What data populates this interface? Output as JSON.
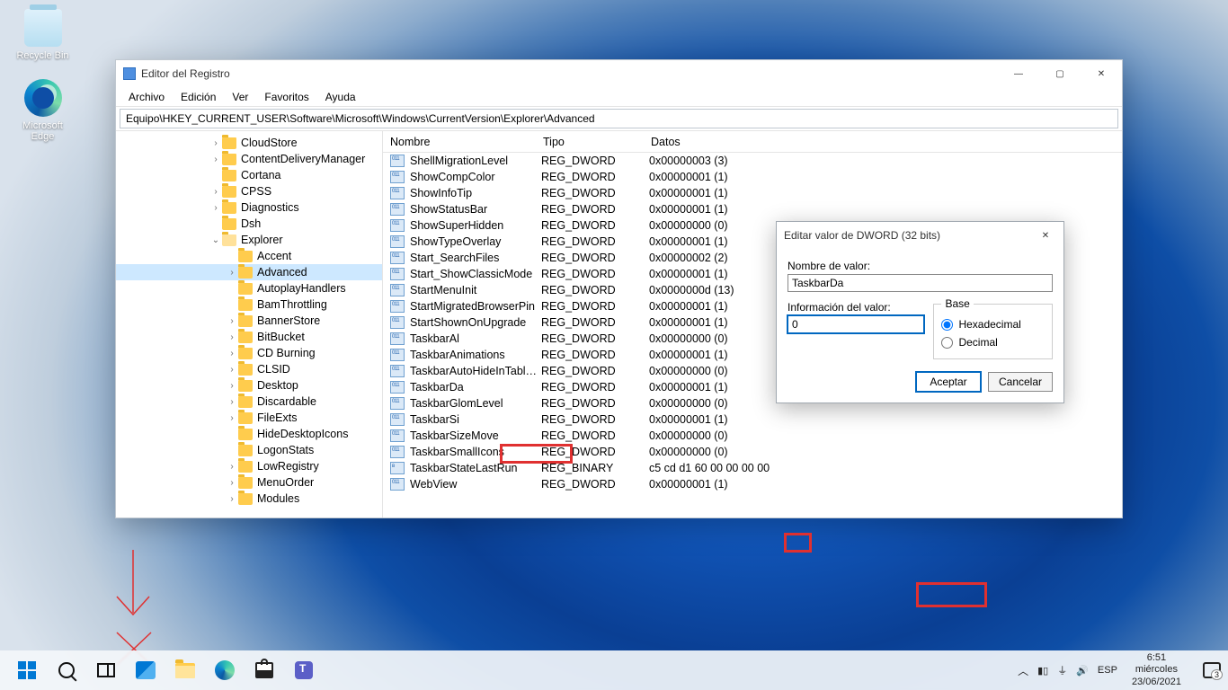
{
  "desktop": {
    "recycle_bin": "Recycle Bin",
    "edge": "Microsoft\nEdge"
  },
  "regedit": {
    "title": "Editor del Registro",
    "menu": [
      "Archivo",
      "Edición",
      "Ver",
      "Favoritos",
      "Ayuda"
    ],
    "address": "Equipo\\HKEY_CURRENT_USER\\Software\\Microsoft\\Windows\\CurrentVersion\\Explorer\\Advanced",
    "tree": [
      {
        "indent": 104,
        "exp": ">",
        "label": "CloudStore"
      },
      {
        "indent": 104,
        "exp": ">",
        "label": "ContentDeliveryManager"
      },
      {
        "indent": 104,
        "exp": "",
        "label": "Cortana"
      },
      {
        "indent": 104,
        "exp": ">",
        "label": "CPSS"
      },
      {
        "indent": 104,
        "exp": ">",
        "label": "Diagnostics"
      },
      {
        "indent": 104,
        "exp": "",
        "label": "Dsh"
      },
      {
        "indent": 104,
        "exp": "v",
        "label": "Explorer",
        "open": true
      },
      {
        "indent": 122,
        "exp": "",
        "label": "Accent"
      },
      {
        "indent": 122,
        "exp": ">",
        "label": "Advanced",
        "selected": true
      },
      {
        "indent": 122,
        "exp": "",
        "label": "AutoplayHandlers"
      },
      {
        "indent": 122,
        "exp": "",
        "label": "BamThrottling"
      },
      {
        "indent": 122,
        "exp": ">",
        "label": "BannerStore"
      },
      {
        "indent": 122,
        "exp": ">",
        "label": "BitBucket"
      },
      {
        "indent": 122,
        "exp": ">",
        "label": "CD Burning"
      },
      {
        "indent": 122,
        "exp": ">",
        "label": "CLSID"
      },
      {
        "indent": 122,
        "exp": ">",
        "label": "Desktop"
      },
      {
        "indent": 122,
        "exp": ">",
        "label": "Discardable"
      },
      {
        "indent": 122,
        "exp": ">",
        "label": "FileExts"
      },
      {
        "indent": 122,
        "exp": "",
        "label": "HideDesktopIcons"
      },
      {
        "indent": 122,
        "exp": "",
        "label": "LogonStats"
      },
      {
        "indent": 122,
        "exp": ">",
        "label": "LowRegistry"
      },
      {
        "indent": 122,
        "exp": ">",
        "label": "MenuOrder"
      },
      {
        "indent": 122,
        "exp": ">",
        "label": "Modules"
      }
    ],
    "columns": {
      "name": "Nombre",
      "type": "Tipo",
      "data": "Datos"
    },
    "values": [
      {
        "n": "ShellMigrationLevel",
        "t": "REG_DWORD",
        "d": "0x00000003 (3)"
      },
      {
        "n": "ShowCompColor",
        "t": "REG_DWORD",
        "d": "0x00000001 (1)"
      },
      {
        "n": "ShowInfoTip",
        "t": "REG_DWORD",
        "d": "0x00000001 (1)"
      },
      {
        "n": "ShowStatusBar",
        "t": "REG_DWORD",
        "d": "0x00000001 (1)"
      },
      {
        "n": "ShowSuperHidden",
        "t": "REG_DWORD",
        "d": "0x00000000 (0)"
      },
      {
        "n": "ShowTypeOverlay",
        "t": "REG_DWORD",
        "d": "0x00000001 (1)"
      },
      {
        "n": "Start_SearchFiles",
        "t": "REG_DWORD",
        "d": "0x00000002 (2)"
      },
      {
        "n": "Start_ShowClassicMode",
        "t": "REG_DWORD",
        "d": "0x00000001 (1)"
      },
      {
        "n": "StartMenuInit",
        "t": "REG_DWORD",
        "d": "0x0000000d (13)"
      },
      {
        "n": "StartMigratedBrowserPin",
        "t": "REG_DWORD",
        "d": "0x00000001 (1)"
      },
      {
        "n": "StartShownOnUpgrade",
        "t": "REG_DWORD",
        "d": "0x00000001 (1)"
      },
      {
        "n": "TaskbarAl",
        "t": "REG_DWORD",
        "d": "0x00000000 (0)"
      },
      {
        "n": "TaskbarAnimations",
        "t": "REG_DWORD",
        "d": "0x00000001 (1)"
      },
      {
        "n": "TaskbarAutoHideInTablet...",
        "t": "REG_DWORD",
        "d": "0x00000000 (0)"
      },
      {
        "n": "TaskbarDa",
        "t": "REG_DWORD",
        "d": "0x00000001 (1)",
        "hl": true
      },
      {
        "n": "TaskbarGlomLevel",
        "t": "REG_DWORD",
        "d": "0x00000000 (0)"
      },
      {
        "n": "TaskbarSi",
        "t": "REG_DWORD",
        "d": "0x00000001 (1)"
      },
      {
        "n": "TaskbarSizeMove",
        "t": "REG_DWORD",
        "d": "0x00000000 (0)"
      },
      {
        "n": "TaskbarSmallIcons",
        "t": "REG_DWORD",
        "d": "0x00000000 (0)"
      },
      {
        "n": "TaskbarStateLastRun",
        "t": "REG_BINARY",
        "d": "c5 cd d1 60 00 00 00 00",
        "bin": true
      },
      {
        "n": "WebView",
        "t": "REG_DWORD",
        "d": "0x00000001 (1)"
      }
    ]
  },
  "dialog": {
    "title": "Editar valor de DWORD (32 bits)",
    "name_label": "Nombre de valor:",
    "name_value": "TaskbarDa",
    "data_label": "Información del valor:",
    "data_value": "0",
    "base_legend": "Base",
    "hex": "Hexadecimal",
    "dec": "Decimal",
    "ok": "Aceptar",
    "cancel": "Cancelar"
  },
  "taskbar": {
    "lang": "ESP",
    "time": "6:51",
    "day": "miércoles",
    "date": "23/06/2021",
    "notif_count": "3"
  }
}
